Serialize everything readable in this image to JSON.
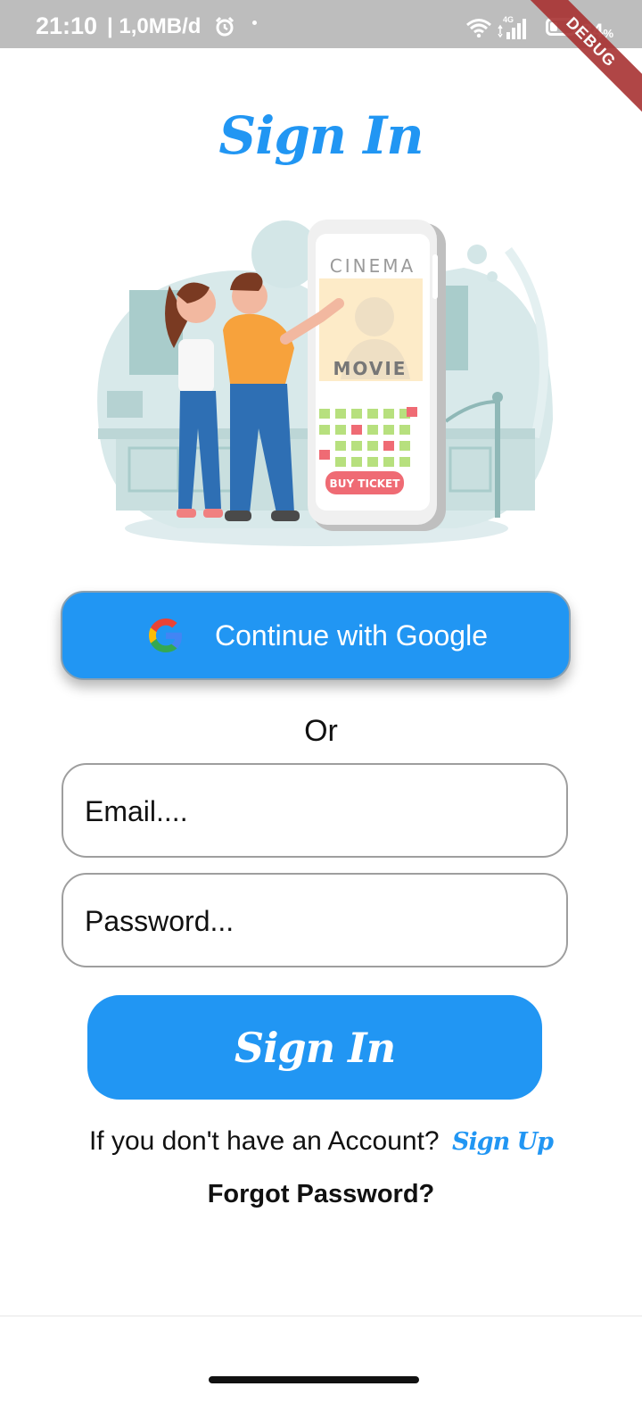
{
  "status_bar": {
    "time": "21:10",
    "network": "| 1,0MB/d",
    "network_type": "4G",
    "battery_percent": "34",
    "battery_unit": "%"
  },
  "debug_banner": "DEBUG",
  "title": "Sign In",
  "illustration": {
    "sign_text": "CINEMA",
    "poster_text": "MOVIE",
    "button_text": "BUY TICKET"
  },
  "google_button": {
    "label": "Continue with Google",
    "icon": "google-g-icon"
  },
  "separator": "Or",
  "email_field": {
    "placeholder": "Email....",
    "value": ""
  },
  "password_field": {
    "placeholder": "Password...",
    "value": ""
  },
  "signin_button": {
    "label": "Sign In"
  },
  "account_prompt": {
    "text": "If you don't have an Account?",
    "link": "Sign Up"
  },
  "forgot_password": "Forgot Password?",
  "colors": {
    "accent": "#2196f3",
    "status_bar": "#bdbdbd",
    "debug": "#a83232"
  }
}
